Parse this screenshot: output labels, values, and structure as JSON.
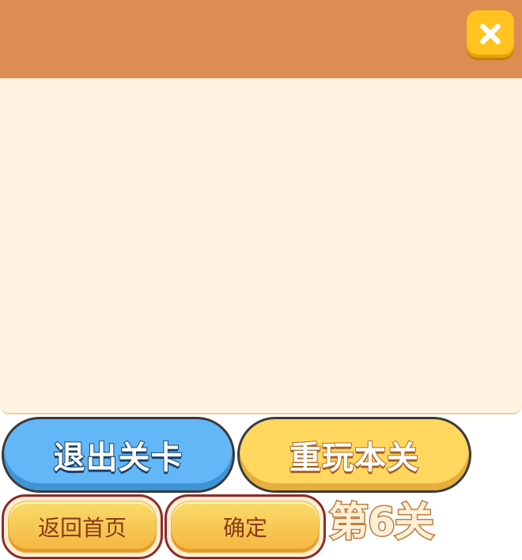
{
  "dialog": {
    "close_icon": "close-x-icon"
  },
  "buttons": {
    "exit_level": "退出关卡",
    "replay_level": "重玩本关",
    "back_home": "返回首页",
    "confirm": "确定"
  },
  "level": {
    "label": "第6关"
  },
  "colors": {
    "header": "#dd8d51",
    "panel": "#fdf3e0",
    "close": "#ffc21f",
    "exit_button": "#63b7f7",
    "replay_button": "#ffd75f",
    "small_button": "#f6c448"
  }
}
